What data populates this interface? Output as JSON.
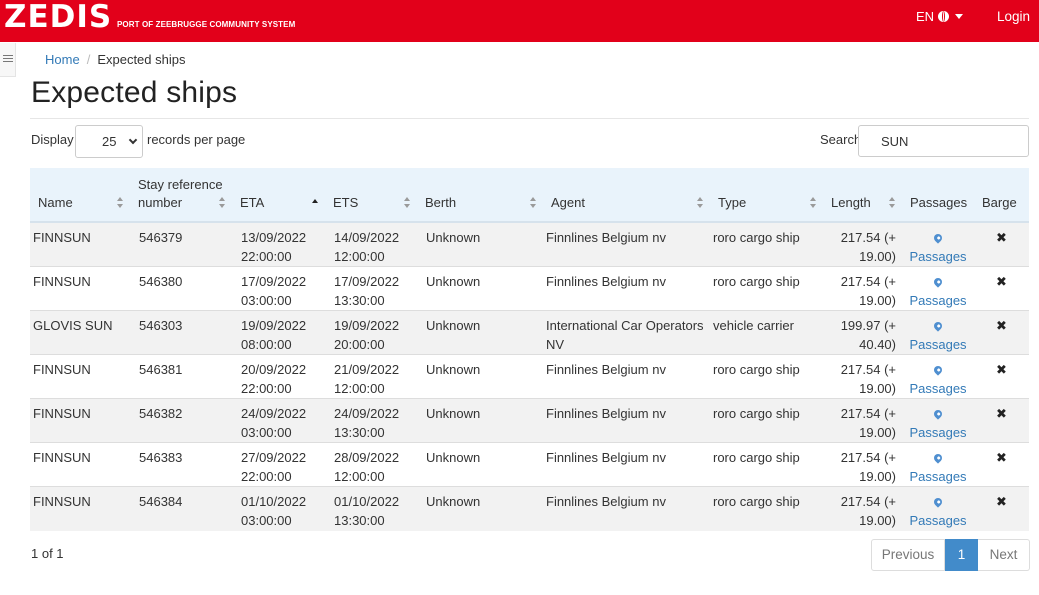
{
  "header": {
    "logo": "ZEDIS",
    "logo_subtitle": "PORT OF ZEEBRUGGE COMMUNITY SYSTEM",
    "language": "EN",
    "login": "Login"
  },
  "breadcrumb": {
    "home": "Home",
    "separator": "/",
    "current": "Expected ships"
  },
  "page_title": "Expected ships",
  "controls": {
    "display_label": "Display",
    "per_page_value": "25",
    "records_label": "records per page",
    "search_label": "Search",
    "search_value": "SUN"
  },
  "table": {
    "columns": [
      "Name",
      "Stay reference number",
      "ETA",
      "ETS",
      "Berth",
      "Agent",
      "Type",
      "Length",
      "Passages",
      "Barge"
    ],
    "rows": [
      {
        "name": "FINNSUN",
        "ref": "546379",
        "eta_date": "13/09/2022",
        "eta_time": "22:00:00",
        "ets_date": "14/09/2022",
        "ets_time": "12:00:00",
        "berth": "Unknown",
        "agent": "Finnlines Belgium nv",
        "type": "roro cargo ship",
        "length_a": "217.54 (+",
        "length_b": "19.00)",
        "passages": "Passages",
        "barge": "✖"
      },
      {
        "name": "FINNSUN",
        "ref": "546380",
        "eta_date": "17/09/2022",
        "eta_time": "03:00:00",
        "ets_date": "17/09/2022",
        "ets_time": "13:30:00",
        "berth": "Unknown",
        "agent": "Finnlines Belgium nv",
        "type": "roro cargo ship",
        "length_a": "217.54 (+",
        "length_b": "19.00)",
        "passages": "Passages",
        "barge": "✖"
      },
      {
        "name": "GLOVIS SUN",
        "ref": "546303",
        "eta_date": "19/09/2022",
        "eta_time": "08:00:00",
        "ets_date": "19/09/2022",
        "ets_time": "20:00:00",
        "berth": "Unknown",
        "agent": "International Car Operators NV",
        "type": "vehicle carrier",
        "length_a": "199.97 (+",
        "length_b": "40.40)",
        "passages": "Passages",
        "barge": "✖"
      },
      {
        "name": "FINNSUN",
        "ref": "546381",
        "eta_date": "20/09/2022",
        "eta_time": "22:00:00",
        "ets_date": "21/09/2022",
        "ets_time": "12:00:00",
        "berth": "Unknown",
        "agent": "Finnlines Belgium nv",
        "type": "roro cargo ship",
        "length_a": "217.54 (+",
        "length_b": "19.00)",
        "passages": "Passages",
        "barge": "✖"
      },
      {
        "name": "FINNSUN",
        "ref": "546382",
        "eta_date": "24/09/2022",
        "eta_time": "03:00:00",
        "ets_date": "24/09/2022",
        "ets_time": "13:30:00",
        "berth": "Unknown",
        "agent": "Finnlines Belgium nv",
        "type": "roro cargo ship",
        "length_a": "217.54 (+",
        "length_b": "19.00)",
        "passages": "Passages",
        "barge": "✖"
      },
      {
        "name": "FINNSUN",
        "ref": "546383",
        "eta_date": "27/09/2022",
        "eta_time": "22:00:00",
        "ets_date": "28/09/2022",
        "ets_time": "12:00:00",
        "berth": "Unknown",
        "agent": "Finnlines Belgium nv",
        "type": "roro cargo ship",
        "length_a": "217.54 (+",
        "length_b": "19.00)",
        "passages": "Passages",
        "barge": "✖"
      },
      {
        "name": "FINNSUN",
        "ref": "546384",
        "eta_date": "01/10/2022",
        "eta_time": "03:00:00",
        "ets_date": "01/10/2022",
        "ets_time": "13:30:00",
        "berth": "Unknown",
        "agent": "Finnlines Belgium nv",
        "type": "roro cargo ship",
        "length_a": "217.54 (+",
        "length_b": "19.00)",
        "passages": "Passages",
        "barge": "✖"
      }
    ]
  },
  "footer": {
    "count": "1 of 1",
    "previous": "Previous",
    "current_page": "1",
    "next": "Next"
  },
  "colors": {
    "brand_red": "#e2001a",
    "link_blue": "#337ab7",
    "header_bg": "#e9f3fb",
    "active_page": "#428bca"
  },
  "icons": {
    "globe": "globe-icon",
    "caret": "caret-down-icon",
    "menu": "hamburger-icon",
    "passages": "map-marker-icon",
    "barge": "times-icon"
  }
}
